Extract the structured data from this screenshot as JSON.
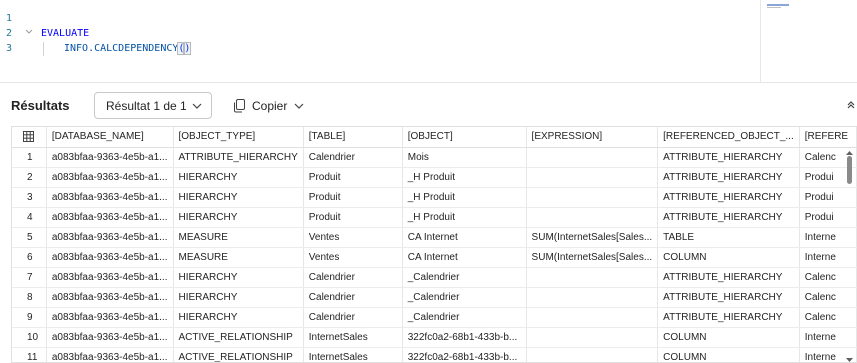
{
  "editor": {
    "line_numbers": [
      "1",
      "2",
      "3"
    ],
    "line2_keyword": "EVALUATE",
    "line3_function": "INFO.CALCDEPENDENCY",
    "line3_paren_open": "(",
    "line3_paren_close": ")"
  },
  "results": {
    "title": "Résultats",
    "result_selector": "Résultat 1 de 1",
    "copy_label": "Copier"
  },
  "grid": {
    "columns": [
      "[DATABASE_NAME]",
      "[OBJECT_TYPE]",
      "[TABLE]",
      "[OBJECT]",
      "[EXPRESSION]",
      "[REFERENCED_OBJECT_...",
      "[REFERE"
    ],
    "rows": [
      [
        "1",
        "a083bfaa-9363-4e5b-a1...",
        "ATTRIBUTE_HIERARCHY",
        "Calendrier",
        "Mois",
        "",
        "ATTRIBUTE_HIERARCHY",
        "Calenc"
      ],
      [
        "2",
        "a083bfaa-9363-4e5b-a1...",
        "HIERARCHY",
        "Produit",
        "_H Produit",
        "",
        "ATTRIBUTE_HIERARCHY",
        "Produi"
      ],
      [
        "3",
        "a083bfaa-9363-4e5b-a1...",
        "HIERARCHY",
        "Produit",
        "_H Produit",
        "",
        "ATTRIBUTE_HIERARCHY",
        "Produi"
      ],
      [
        "4",
        "a083bfaa-9363-4e5b-a1...",
        "HIERARCHY",
        "Produit",
        "_H Produit",
        "",
        "ATTRIBUTE_HIERARCHY",
        "Produi"
      ],
      [
        "5",
        "a083bfaa-9363-4e5b-a1...",
        "MEASURE",
        "Ventes",
        "CA Internet",
        "SUM(InternetSales[Sales...",
        "TABLE",
        "Interne"
      ],
      [
        "6",
        "a083bfaa-9363-4e5b-a1...",
        "MEASURE",
        "Ventes",
        "CA Internet",
        "SUM(InternetSales[Sales...",
        "COLUMN",
        "Interne"
      ],
      [
        "7",
        "a083bfaa-9363-4e5b-a1...",
        "HIERARCHY",
        "Calendrier",
        "_Calendrier",
        "",
        "ATTRIBUTE_HIERARCHY",
        "Calenc"
      ],
      [
        "8",
        "a083bfaa-9363-4e5b-a1...",
        "HIERARCHY",
        "Calendrier",
        "_Calendrier",
        "",
        "ATTRIBUTE_HIERARCHY",
        "Calenc"
      ],
      [
        "9",
        "a083bfaa-9363-4e5b-a1...",
        "HIERARCHY",
        "Calendrier",
        "_Calendrier",
        "",
        "ATTRIBUTE_HIERARCHY",
        "Calenc"
      ],
      [
        "10",
        "a083bfaa-9363-4e5b-a1...",
        "ACTIVE_RELATIONSHIP",
        "InternetSales",
        "322fc0a2-68b1-433b-b...",
        "",
        "COLUMN",
        "Interne"
      ],
      [
        "11",
        "a083bfaa-9363-4e5b-a1...",
        "ACTIVE_RELATIONSHIP",
        "InternetSales",
        "322fc0a2-68b1-433b-b...",
        "",
        "COLUMN",
        "Interne"
      ]
    ]
  },
  "colors": {
    "keyword": "#0000ff",
    "function": "#0451a5",
    "line_number": "#237893"
  },
  "icons": {
    "fold": "chevron-down-icon",
    "copy": "copy-icon",
    "expand": "collapse-arrows-icon",
    "grid": "table-grid-icon"
  }
}
